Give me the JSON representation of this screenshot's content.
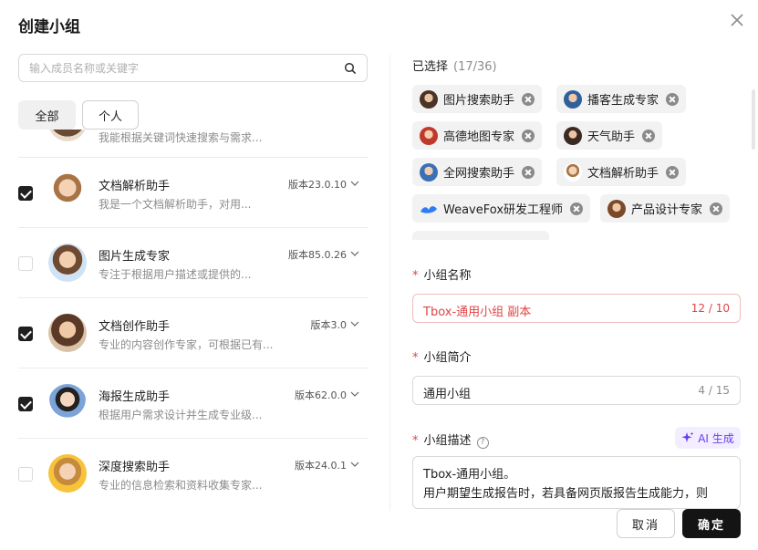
{
  "dialog": {
    "title": "创建小组"
  },
  "search": {
    "placeholder": "输入成员名称或关键字"
  },
  "filters": [
    {
      "label": "全部"
    },
    {
      "label": "个人"
    }
  ],
  "assistants": [
    {
      "name": "",
      "desc": "我能根据关键词快速搜索与需求...",
      "version": "",
      "checked": false
    },
    {
      "name": "文档解析助手",
      "desc": "我是一个文档解析助手，对用...",
      "version": "版本23.0.10",
      "checked": true
    },
    {
      "name": "图片生成专家",
      "desc": "专注于根据用户描述或提供的...",
      "version": "版本85.0.26",
      "checked": false
    },
    {
      "name": "文档创作助手",
      "desc": "专业的内容创作专家，可根据已有...",
      "version": "版本3.0",
      "checked": true
    },
    {
      "name": "海报生成助手",
      "desc": "根据用户需求设计并生成专业级...",
      "version": "版本62.0.0",
      "checked": true
    },
    {
      "name": "深度搜索助手",
      "desc": "专业的信息检索和资料收集专家...",
      "version": "版本24.0.1",
      "checked": false
    }
  ],
  "selected": {
    "label": "已选择",
    "count": "(17/36)",
    "chips": [
      {
        "label": "图片搜索助手"
      },
      {
        "label": "播客生成专家"
      },
      {
        "label": "高德地图专家"
      },
      {
        "label": "天气助手"
      },
      {
        "label": "全网搜索助手"
      },
      {
        "label": "文档解析助手"
      },
      {
        "label": "WeaveFox研发工程师"
      },
      {
        "label": "产品设计专家"
      }
    ]
  },
  "form": {
    "name": {
      "label": "小组名称",
      "value": "Tbox-通用小组 副本",
      "count": "12 / 10"
    },
    "intro": {
      "label": "小组简介",
      "value": "通用小组",
      "count": "4 / 15"
    },
    "desc": {
      "label": "小组描述",
      "help": "?",
      "ai_label": "AI 生成",
      "line1": "Tbox-通用小组。",
      "line2": "用户期望生成报告时，若具备网页版报告生成能力，则"
    }
  },
  "actions": {
    "cancel": "取消",
    "ok": "确定"
  },
  "colors": {
    "primary": "#141414",
    "error": "#e04444",
    "ai": "#6a3df0"
  }
}
